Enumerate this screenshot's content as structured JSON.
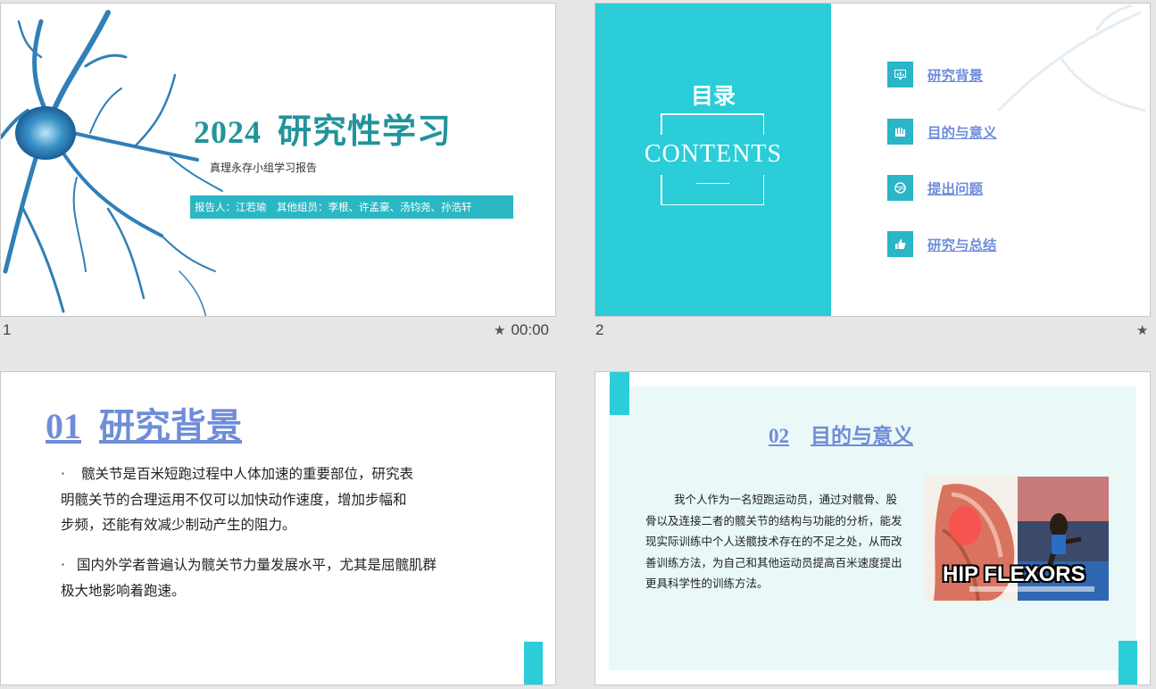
{
  "slides": [
    {
      "number": "1",
      "time": "00:00",
      "title_year": "2024",
      "title_text": "研究性学习",
      "subtitle": "真理永存小组学习报告",
      "bar_text": "报告人：江若瑜　其他组员：李根、许孟豪、汤钧尧、孙浩轩"
    },
    {
      "number": "2",
      "heading": "目录",
      "contents": "CONTENTS",
      "items": [
        {
          "label": "研究背景",
          "icon": "chart-icon"
        },
        {
          "label": "目的与意义",
          "icon": "hand-icon"
        },
        {
          "label": "提出问题",
          "icon": "ball-icon"
        },
        {
          "label": "研究与总结",
          "icon": "thumbs-up-icon"
        }
      ]
    },
    {
      "title_num": "01",
      "title_text": "研究背景",
      "bullet_mark": "·",
      "para1_lines": [
        "髋关节是百米短跑过程中人体加速的重要部位，研究表",
        "明髋关节的合理运用不仅可以加快动作速度，增加步幅和",
        "步频，还能有效减少制动产生的阻力。"
      ],
      "para2_lines": [
        "国内外学者普遍认为髋关节力量发展水平，尤其是屈髋肌群",
        "极大地影响着跑速。"
      ]
    },
    {
      "title_num": "02",
      "title_text": "目的与意义",
      "body": "我个人作为一名短跑运动员，通过对髋骨、股骨以及连接二者的髋关节的结构与功能的分析，能发现实际训练中个人送髋技术存在的不足之处，从而改善训练方法，为自己和其他运动员提高百米速度提出更具科学性的训练方法。",
      "image_caption": "HIP FLEXORS"
    }
  ],
  "colors": {
    "accent": "#2acdd8",
    "title_teal": "#22949a",
    "link_blue": "#6f8dd8",
    "panel_light": "#eaf8f8"
  }
}
